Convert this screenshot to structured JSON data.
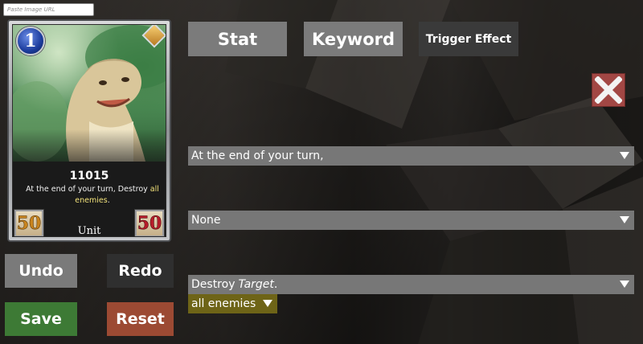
{
  "image_url": {
    "placeholder": "Paste Image URL",
    "value": ""
  },
  "card": {
    "cost": "1",
    "name": "11015",
    "text_before": "At the end of your turn, Destroy ",
    "text_highlight": "all enemies",
    "text_after": ".",
    "attack": "50",
    "health": "50",
    "type": "Unit"
  },
  "actions": {
    "undo": "Undo",
    "redo": "Redo",
    "save": "Save",
    "reset": "Reset"
  },
  "tabs": {
    "stat": "Stat",
    "keyword": "Keyword",
    "trigger": "Trigger Effect"
  },
  "effect": {
    "trigger_value": "At the end of your turn,",
    "condition_value": "None",
    "action_prefix": "Destroy",
    "action_keyword": "Target",
    "action_suffix": ".",
    "target_value": "all enemies"
  },
  "colors": {
    "undo": "#7a7a7a",
    "redo": "#2f2f2f",
    "save": "#3d7a35",
    "reset": "#9c4a33",
    "close": "#a24744",
    "target_select": "#6e6417"
  }
}
